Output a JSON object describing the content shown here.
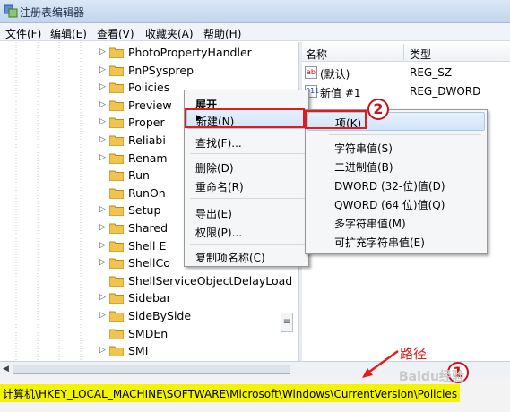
{
  "window": {
    "title": "注册表编辑器"
  },
  "menu": [
    "文件(F)",
    "编辑(E)",
    "查看(V)",
    "收藏夹(A)",
    "帮助(H)"
  ],
  "tree": {
    "items": [
      "PhotoPropertyHandler",
      "PnPSysprep",
      "Policies",
      "Preview",
      "Proper",
      "Reliabi",
      "Renam",
      "Run",
      "RunOn",
      "Setup",
      "Shared",
      "Shell E",
      "ShellCo",
      "ShellServiceObjectDelayLoad",
      "Sidebar",
      "SideBySide",
      "SMDEn",
      "SMI"
    ]
  },
  "list": {
    "columns": {
      "name": "名称",
      "type": "类型"
    },
    "rows": [
      {
        "icon": "ab",
        "name": "(默认)",
        "type": "REG_SZ"
      },
      {
        "icon": "011",
        "name": "新值 #1",
        "type": "REG_DWORD"
      }
    ]
  },
  "context_menu": {
    "items": [
      "展开",
      "新建(N)",
      "查找(F)...",
      "删除(D)",
      "重命名(R)",
      "导出(E)",
      "权限(P)...",
      "复制项名称(C)"
    ]
  },
  "submenu": {
    "items": [
      "项(K)",
      "字符串值(S)",
      "二进制值(B)",
      "DWORD (32-位)值(D)",
      "QWORD (64 位)值(Q)",
      "多字符串值(M)",
      "可扩充字符串值(E)"
    ]
  },
  "status": {
    "path": "计算机\\HKEY_LOCAL_MACHINE\\SOFTWARE\\Microsoft\\Windows\\CurrentVersion\\Policies"
  },
  "annotations": {
    "circle_1": "1",
    "circle_2": "2",
    "path_label": "路径",
    "watermark": "Baidu经验"
  },
  "colors": {
    "highlight_yellow": "#f4f400",
    "annotation_red": "#e01d1d"
  }
}
